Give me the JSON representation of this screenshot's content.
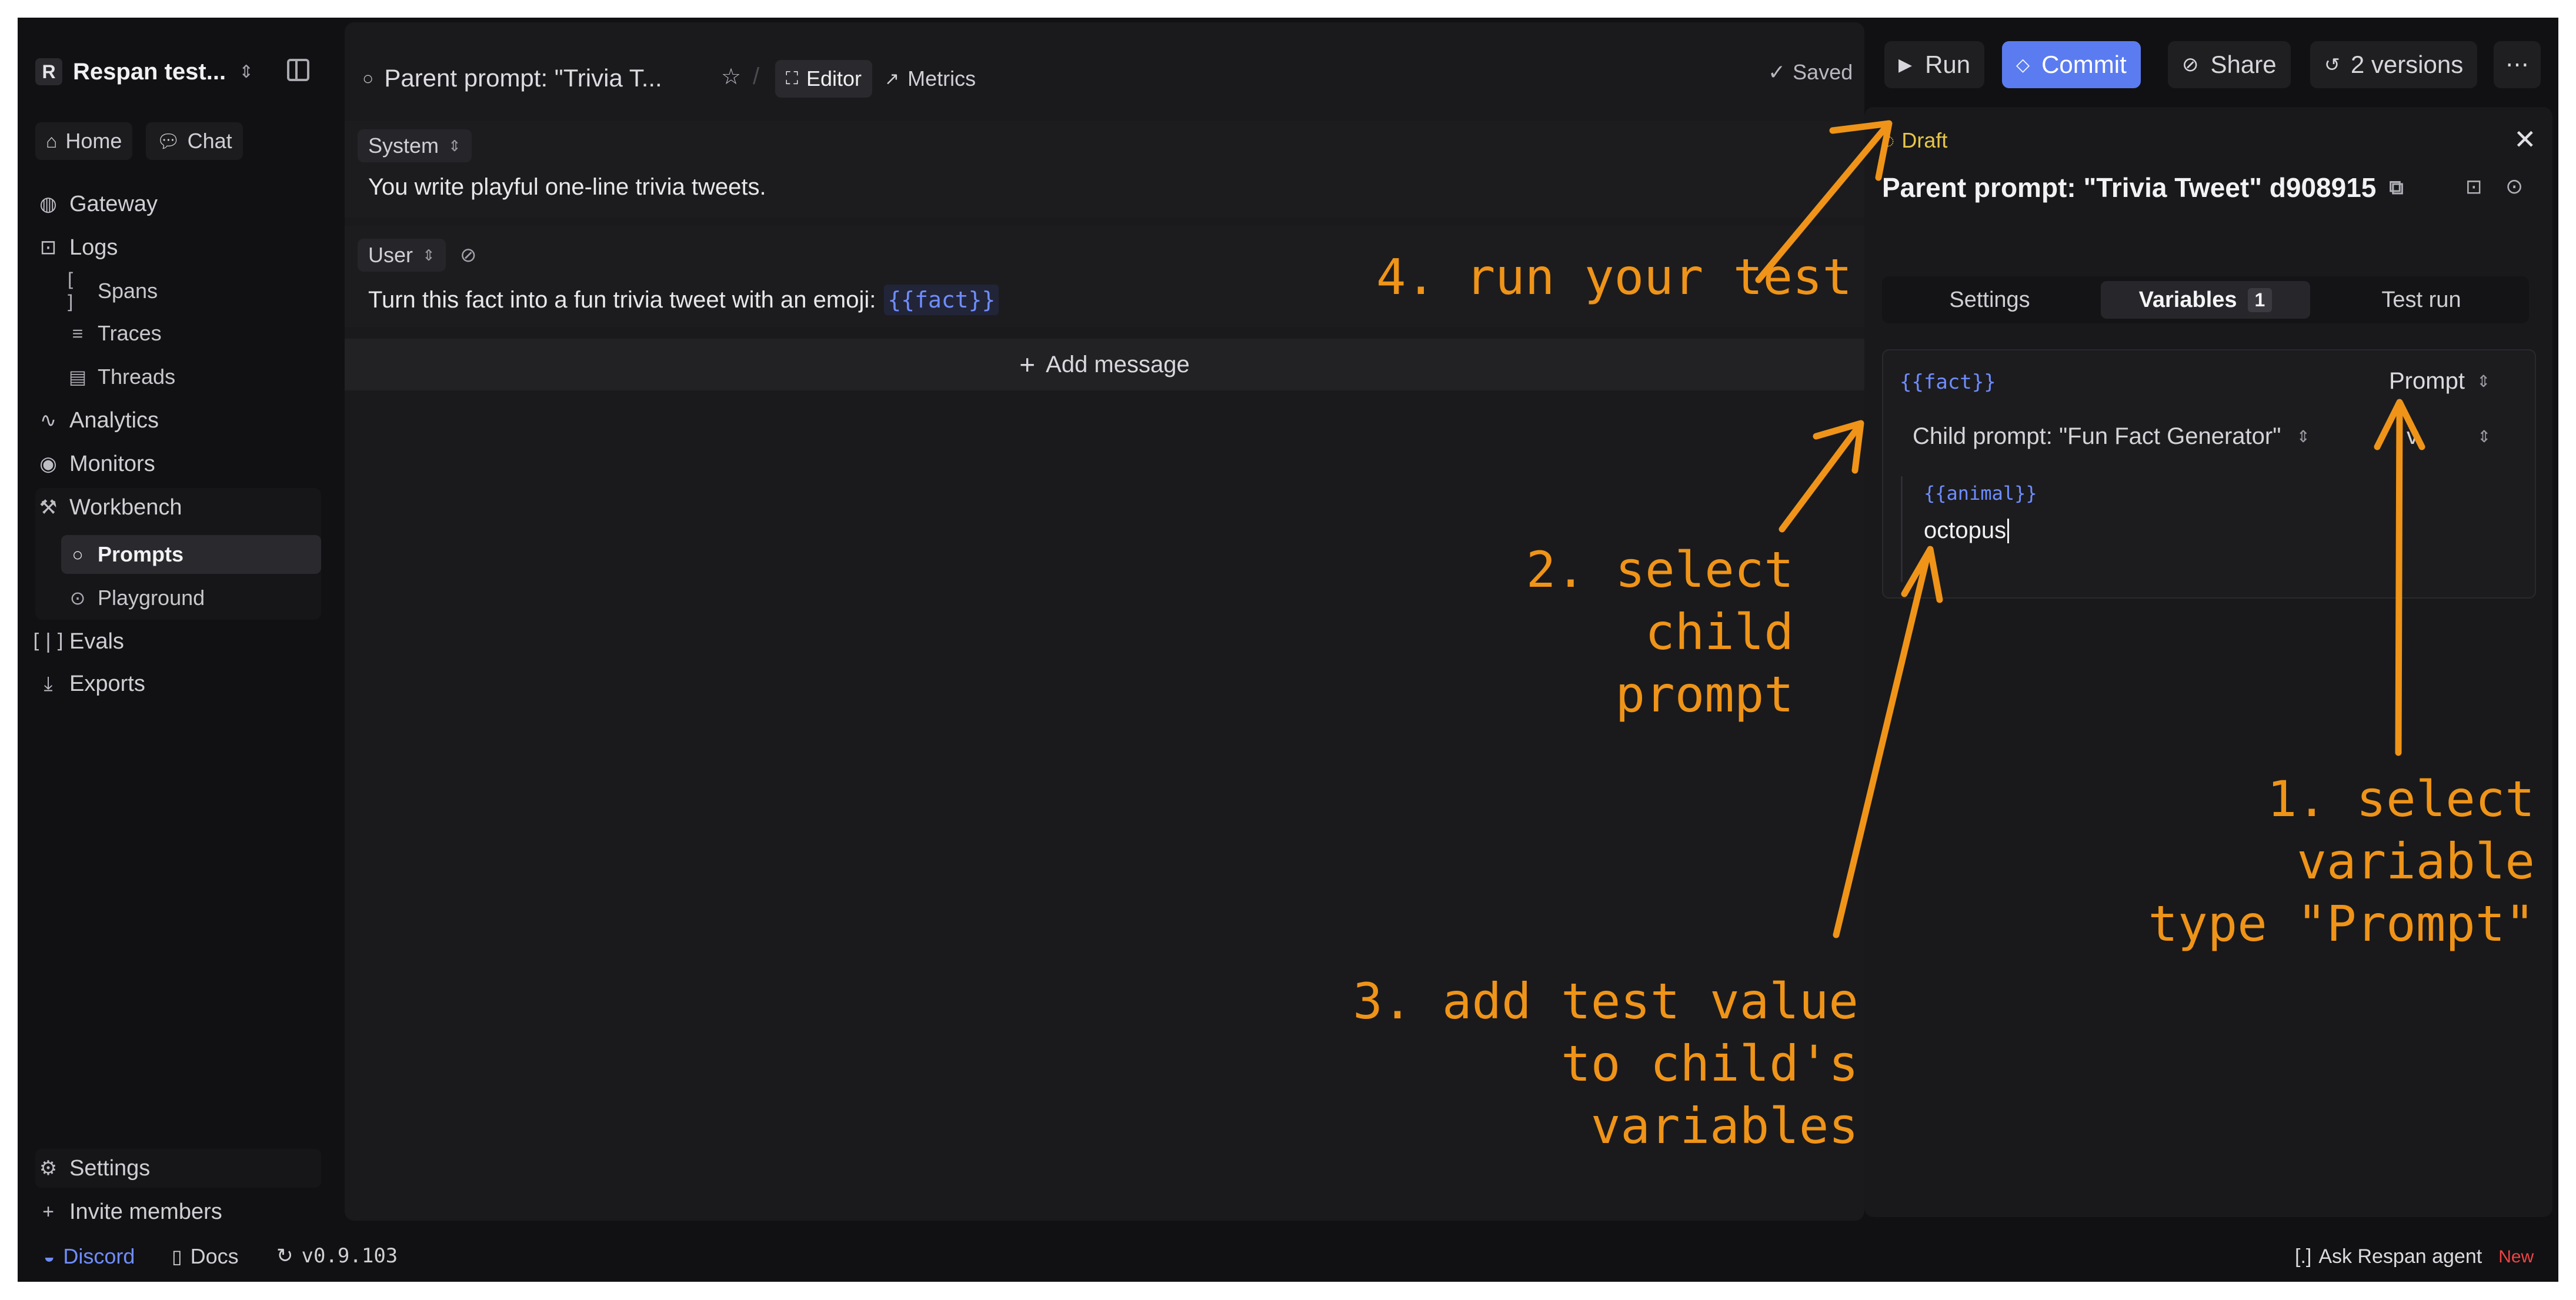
{
  "workspace": {
    "initial": "R",
    "name": "Respan test..."
  },
  "sidebar": {
    "top": [
      {
        "label": "Home"
      },
      {
        "label": "Chat"
      }
    ],
    "items": [
      {
        "label": "Gateway"
      },
      {
        "label": "Logs"
      },
      {
        "label": "Spans"
      },
      {
        "label": "Traces"
      },
      {
        "label": "Threads"
      },
      {
        "label": "Analytics"
      },
      {
        "label": "Monitors"
      },
      {
        "label": "Workbench"
      },
      {
        "label": "Prompts"
      },
      {
        "label": "Playground"
      },
      {
        "label": "Evals"
      },
      {
        "label": "Exports"
      }
    ],
    "bottom": [
      {
        "label": "Settings"
      },
      {
        "label": "Invite members"
      }
    ]
  },
  "header": {
    "breadcrumb": "Parent prompt: \"Trivia T...",
    "tabs": [
      {
        "label": "Editor"
      },
      {
        "label": "Metrics"
      }
    ],
    "saved": "Saved",
    "run": "Run",
    "commit": "Commit",
    "share": "Share",
    "versions": "2 versions"
  },
  "editor": {
    "system_role": "System",
    "system_text": "You write playful one-line trivia tweets.",
    "user_role": "User",
    "user_text": "Turn this fact into a fun trivia tweet with an emoji:",
    "user_var": "{{fact}}",
    "add_message": "Add message"
  },
  "panel": {
    "draft": "Draft",
    "title": "Parent prompt: \"Trivia Tweet\" d908915",
    "tabs": [
      {
        "label": "Settings"
      },
      {
        "label": "Variables",
        "badge": "1"
      },
      {
        "label": "Test run"
      }
    ],
    "var_name": "{{fact}}",
    "var_type": "Prompt",
    "child_prompt": "Child prompt: \"Fun Fact Generator\"",
    "version_short": "v",
    "child_var": "{{animal}}",
    "child_value": "octopus"
  },
  "annotations": {
    "step4": "4. run your test",
    "step2": [
      "2. select child",
      "prompt"
    ],
    "step1": [
      "1. select variable",
      "type \"Prompt\""
    ],
    "step3": [
      "3. add test value",
      "to child's variables"
    ]
  },
  "statusbar": {
    "discord": "Discord",
    "docs": "Docs",
    "version": "v0.9.103",
    "agent_prefix": "[.]",
    "agent": "Ask Respan agent",
    "new_badge": "New"
  },
  "colors": {
    "accent": "#5b7cf0",
    "annotation": "#ef9418",
    "variable": "#6f8dff",
    "draft": "#e7c64a",
    "new": "#ef4444"
  }
}
